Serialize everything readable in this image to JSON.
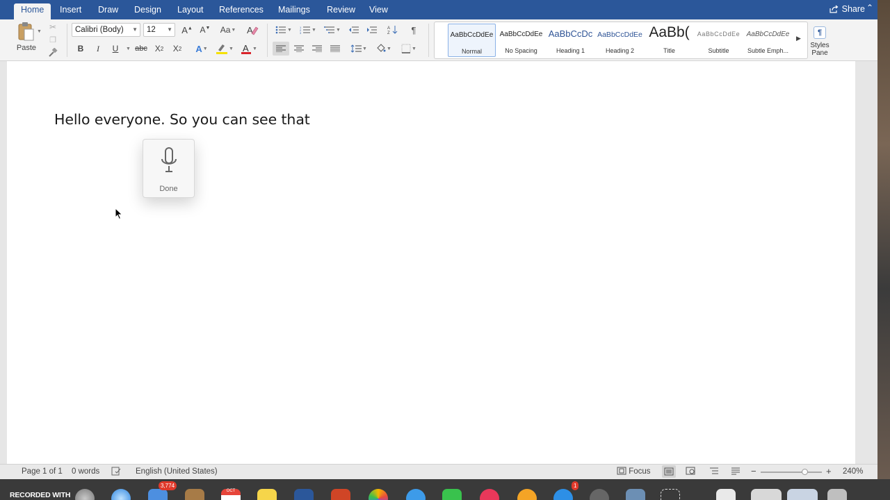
{
  "tabs": [
    {
      "label": "Home",
      "active": true
    },
    {
      "label": "Insert"
    },
    {
      "label": "Draw"
    },
    {
      "label": "Design"
    },
    {
      "label": "Layout"
    },
    {
      "label": "References"
    },
    {
      "label": "Mailings"
    },
    {
      "label": "Review"
    },
    {
      "label": "View"
    }
  ],
  "share_label": "Share",
  "ribbon": {
    "paste_label": "Paste",
    "font_name": "Calibri (Body)",
    "font_size": "12",
    "bold": "B",
    "italic": "I",
    "underline": "U",
    "strike": "abc",
    "subscript": "X",
    "superscript": "X",
    "highlight_color": "#f5e100",
    "font_color": "#d9232a",
    "styles_pane_label": "Styles Pane",
    "styles": [
      {
        "sample": "AaBbCcDdEe",
        "name": "Normal",
        "selected": true
      },
      {
        "sample": "AaBbCcDdEe",
        "name": "No Spacing"
      },
      {
        "sample": "AaBbCcDc",
        "name": "Heading 1"
      },
      {
        "sample": "AaBbCcDdEe",
        "name": "Heading 2"
      },
      {
        "sample": "AaBb(",
        "name": "Title"
      },
      {
        "sample": "AaBbCcDdEe",
        "name": "Subtitle"
      },
      {
        "sample": "AaBbCcDdEe",
        "name": "Subtle Emph..."
      }
    ]
  },
  "document": {
    "text": "Hello everyone. So you can see that"
  },
  "dictation": {
    "done_label": "Done"
  },
  "status": {
    "page": "Page 1 of 1",
    "words": "0 words",
    "language": "English (United States)",
    "focus": "Focus",
    "zoom": "240%",
    "zoom_fraction": 0.72
  },
  "dock": {
    "recorded": "RECORDED WITH",
    "mail_badge": "3,774",
    "cal_month": "OCT",
    "appstore_badge": "1"
  }
}
